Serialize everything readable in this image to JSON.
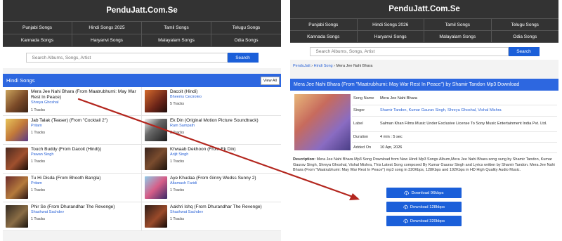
{
  "left": {
    "site_title": "PenduJatt.Com.Se",
    "categories": [
      "Punjabi Songs",
      "Hindi Songs 2025",
      "Tamil Songs",
      "Telugu Songs",
      "Kannada Songs",
      "Haryanvi Songs",
      "Malayalam Songs",
      "Odia Songs"
    ],
    "search": {
      "placeholder": "Search Albums, Songs, Artist",
      "button_label": "Search"
    },
    "section_title": "Hindi Songs",
    "view_all_label": "View All",
    "songs": [
      {
        "title": "Mera Jee Nahi Bhara (From Maatrubhumi: May War Rest In Peace)",
        "artist": "Shreya Ghoshal",
        "tracks": "1 Tracks"
      },
      {
        "title": "Dacoit (Hindi)",
        "artist": "Bheems Ceciroleo",
        "tracks": "5 Tracks"
      },
      {
        "title": "Jab Talak (Teaser) (From \"Cocktail 2\")",
        "artist": "Pritam",
        "tracks": "1 Tracks"
      },
      {
        "title": "Ek Din (Original Motion Picture Soundtrack)",
        "artist": "Ram Sampath",
        "tracks": "3 Tracks"
      },
      {
        "title": "Touch Buddy (From Dacoit (Hindi))",
        "artist": "Pawan Singh",
        "tracks": "1 Tracks"
      },
      {
        "title": "Khwaab Dekhoon (From Ek Din)",
        "artist": "Arijit Singh",
        "tracks": "1 Tracks"
      },
      {
        "title": "Tu Hi Disda (From Bhooth Bangla)",
        "artist": "Pritam",
        "tracks": "1 Tracks"
      },
      {
        "title": "Aye Khudaa (From Ginny Wedss Sunny 2)",
        "artist": "Altamash Faridi",
        "tracks": "1 Tracks"
      },
      {
        "title": "Phir Se (From Dhurandhar The Revenge)",
        "artist": "Shashwat Sachdev",
        "tracks": "1 Tracks"
      },
      {
        "title": "Aakhri Ishq (From Dhurandhar The Revenge)",
        "artist": "Shashwat Sachdev",
        "tracks": "1 Tracks"
      }
    ]
  },
  "right": {
    "site_title": "PenduJatt.Com.Se",
    "categories": [
      "Punjabi Songs",
      "Hindi Songs 2026",
      "Tamil Songs",
      "Telugu Songs",
      "Kannada Songs",
      "Haryanvi Songs",
      "Malayalam Songs",
      "Odia Songs"
    ],
    "search": {
      "placeholder": "Search Albums, Songs, Artist",
      "button_label": "Search"
    },
    "breadcrumb": {
      "home": "PenduJatt",
      "sep1": " › ",
      "section": "Hindi Song",
      "sep2": " › ",
      "current": "Mera Jee Nahi Bhara"
    },
    "detail_title": "Mera Jee Nahi Bhara (From \"Maatrubhumi: May War Rest In Peace\") by Shamir Tandon Mp3 Download",
    "info": [
      {
        "key": "Song Name",
        "value": "Mera Jee Nahi Bhara",
        "link": false
      },
      {
        "key": "Singer",
        "value": "Shamir Tandon, Kumar Gaurav Singh, Shreya Ghoshal, Vishal Mishra",
        "link": true
      },
      {
        "key": "Label",
        "value": "Salman Khan Films Music Under Exclusive License To Sony Music Entertainment India Pvt. Ltd.",
        "link": false
      },
      {
        "key": "Duration",
        "value": "4 min : 5 sec",
        "link": false
      },
      {
        "key": "Added On",
        "value": "10 Apr, 2026",
        "link": false
      }
    ],
    "description_label": "Description:",
    "description_text": " Mera Jee Nahi Bhara Mp3 Song Download from New Hindi Mp3 Songs Album,Mera Jee Nahi Bhara song sung by Shamir Tandon, Kumar Gaurav Singh, Shreya Ghoshal, Vishal Mishra, This Latest Song composed By Kumar Gaurav Singh and Lyrics written by Shamir Tandon. Mera Jee Nahi Bhara (From \"Maatrubhumi: May War Rest In Peace\") mp3 song in 320Kbps, 128Kbps and 192Kbps in HD High Quality Audio Music.",
    "downloads": [
      "Download 96kbps",
      "Download 128kbps",
      "Download 320kbps"
    ]
  },
  "colors": {
    "accent_blue": "#2d67e0",
    "header_dark": "#333333",
    "link_blue": "#2b63d6",
    "arrow_red": "#b3261e"
  },
  "icons": {
    "download": "cloud-download-icon"
  }
}
